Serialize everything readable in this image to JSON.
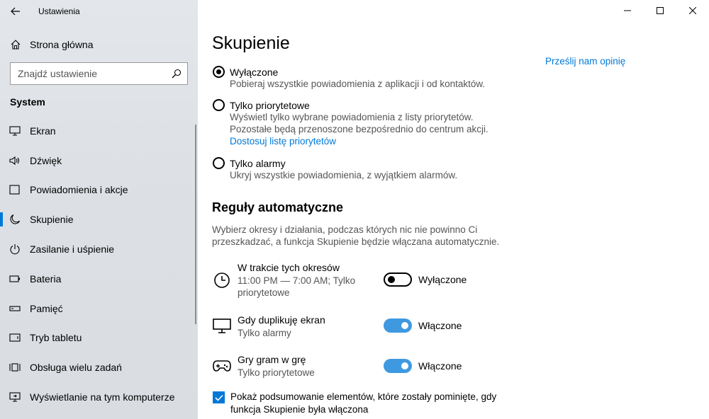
{
  "app": {
    "title": "Ustawienia"
  },
  "window": {
    "controls": [
      "minimize-icon",
      "maximize-icon",
      "close-icon"
    ]
  },
  "sidebar": {
    "home_label": "Strona główna",
    "search_placeholder": "Znajdź ustawienie",
    "section": "System",
    "items": [
      {
        "label": "Ekran",
        "icon": "display-icon"
      },
      {
        "label": "Dźwięk",
        "icon": "speaker-icon"
      },
      {
        "label": "Powiadomienia i akcje",
        "icon": "notification-icon"
      },
      {
        "label": "Skupienie",
        "icon": "moon-icon",
        "active": true
      },
      {
        "label": "Zasilanie i uśpienie",
        "icon": "power-icon"
      },
      {
        "label": "Bateria",
        "icon": "battery-icon"
      },
      {
        "label": "Pamięć",
        "icon": "storage-icon"
      },
      {
        "label": "Tryb tabletu",
        "icon": "tablet-icon"
      },
      {
        "label": "Obsługa wielu zadań",
        "icon": "multitasking-icon"
      },
      {
        "label": "Wyświetlanie na tym komputerze",
        "icon": "project-icon"
      }
    ]
  },
  "main": {
    "title": "Skupienie",
    "feedback_link": "Prześlij nam opinię",
    "options": [
      {
        "label": "Wyłączone",
        "selected": true,
        "desc": [
          "Pobieraj wszystkie powiadomienia z aplikacji i od kontaktów."
        ]
      },
      {
        "label": "Tylko priorytetowe",
        "selected": false,
        "desc": [
          "Wyświetl tylko wybrane powiadomienia z listy priorytetów.",
          "Pozostałe będą przenoszone bezpośrednio do centrum akcji."
        ],
        "link": "Dostosuj listę priorytetów"
      },
      {
        "label": "Tylko alarmy",
        "selected": false,
        "desc": [
          "Ukryj wszystkie powiadomienia, z wyjątkiem alarmów."
        ]
      }
    ],
    "rules_heading": "Reguły automatyczne",
    "rules_intro": "Wybierz okresy i działania, podczas których nic nie powinno Ci przeszkadzać, a funkcja Skupienie będzie włączana automatycznie.",
    "rules": [
      {
        "title": "W trakcie tych okresów",
        "subtitle": "11:00 PM — 7:00 AM; Tylko priorytetowe",
        "state": "Wyłączone",
        "on": false,
        "icon": "clock-icon"
      },
      {
        "title": "Gdy duplikuję ekran",
        "subtitle": "Tylko alarmy",
        "state": "Włączone",
        "on": true,
        "icon": "monitor-icon"
      },
      {
        "title": "Gry gram w grę",
        "subtitle": "Tylko priorytetowe",
        "state": "Włączone",
        "on": true,
        "icon": "gamepad-icon"
      }
    ],
    "summary_checkbox": {
      "checked": true,
      "label": "Pokaż podsumowanie elementów, które zostały pominięte, gdy funkcja Skupienie była włączona"
    }
  },
  "colors": {
    "accent": "#0078d7",
    "sidebar_bg": "#dde1e5"
  }
}
